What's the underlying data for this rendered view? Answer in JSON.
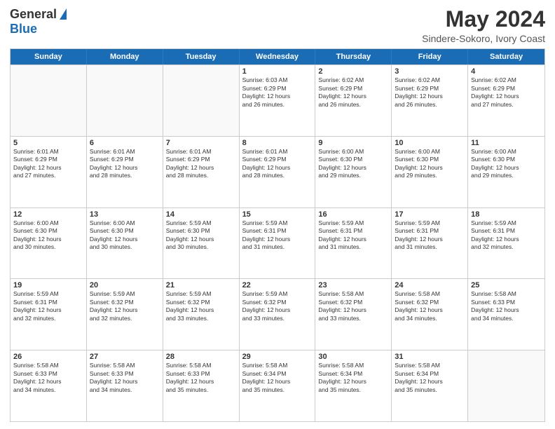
{
  "header": {
    "logo_general": "General",
    "logo_blue": "Blue",
    "month_title": "May 2024",
    "location": "Sindere-Sokoro, Ivory Coast"
  },
  "days_of_week": [
    "Sunday",
    "Monday",
    "Tuesday",
    "Wednesday",
    "Thursday",
    "Friday",
    "Saturday"
  ],
  "weeks": [
    [
      {
        "day": "",
        "info": "",
        "empty": true
      },
      {
        "day": "",
        "info": "",
        "empty": true
      },
      {
        "day": "",
        "info": "",
        "empty": true
      },
      {
        "day": "1",
        "info": "Sunrise: 6:03 AM\nSunset: 6:29 PM\nDaylight: 12 hours\nand 26 minutes.",
        "empty": false
      },
      {
        "day": "2",
        "info": "Sunrise: 6:02 AM\nSunset: 6:29 PM\nDaylight: 12 hours\nand 26 minutes.",
        "empty": false
      },
      {
        "day": "3",
        "info": "Sunrise: 6:02 AM\nSunset: 6:29 PM\nDaylight: 12 hours\nand 26 minutes.",
        "empty": false
      },
      {
        "day": "4",
        "info": "Sunrise: 6:02 AM\nSunset: 6:29 PM\nDaylight: 12 hours\nand 27 minutes.",
        "empty": false
      }
    ],
    [
      {
        "day": "5",
        "info": "Sunrise: 6:01 AM\nSunset: 6:29 PM\nDaylight: 12 hours\nand 27 minutes.",
        "empty": false
      },
      {
        "day": "6",
        "info": "Sunrise: 6:01 AM\nSunset: 6:29 PM\nDaylight: 12 hours\nand 28 minutes.",
        "empty": false
      },
      {
        "day": "7",
        "info": "Sunrise: 6:01 AM\nSunset: 6:29 PM\nDaylight: 12 hours\nand 28 minutes.",
        "empty": false
      },
      {
        "day": "8",
        "info": "Sunrise: 6:01 AM\nSunset: 6:29 PM\nDaylight: 12 hours\nand 28 minutes.",
        "empty": false
      },
      {
        "day": "9",
        "info": "Sunrise: 6:00 AM\nSunset: 6:30 PM\nDaylight: 12 hours\nand 29 minutes.",
        "empty": false
      },
      {
        "day": "10",
        "info": "Sunrise: 6:00 AM\nSunset: 6:30 PM\nDaylight: 12 hours\nand 29 minutes.",
        "empty": false
      },
      {
        "day": "11",
        "info": "Sunrise: 6:00 AM\nSunset: 6:30 PM\nDaylight: 12 hours\nand 29 minutes.",
        "empty": false
      }
    ],
    [
      {
        "day": "12",
        "info": "Sunrise: 6:00 AM\nSunset: 6:30 PM\nDaylight: 12 hours\nand 30 minutes.",
        "empty": false
      },
      {
        "day": "13",
        "info": "Sunrise: 6:00 AM\nSunset: 6:30 PM\nDaylight: 12 hours\nand 30 minutes.",
        "empty": false
      },
      {
        "day": "14",
        "info": "Sunrise: 5:59 AM\nSunset: 6:30 PM\nDaylight: 12 hours\nand 30 minutes.",
        "empty": false
      },
      {
        "day": "15",
        "info": "Sunrise: 5:59 AM\nSunset: 6:31 PM\nDaylight: 12 hours\nand 31 minutes.",
        "empty": false
      },
      {
        "day": "16",
        "info": "Sunrise: 5:59 AM\nSunset: 6:31 PM\nDaylight: 12 hours\nand 31 minutes.",
        "empty": false
      },
      {
        "day": "17",
        "info": "Sunrise: 5:59 AM\nSunset: 6:31 PM\nDaylight: 12 hours\nand 31 minutes.",
        "empty": false
      },
      {
        "day": "18",
        "info": "Sunrise: 5:59 AM\nSunset: 6:31 PM\nDaylight: 12 hours\nand 32 minutes.",
        "empty": false
      }
    ],
    [
      {
        "day": "19",
        "info": "Sunrise: 5:59 AM\nSunset: 6:31 PM\nDaylight: 12 hours\nand 32 minutes.",
        "empty": false
      },
      {
        "day": "20",
        "info": "Sunrise: 5:59 AM\nSunset: 6:32 PM\nDaylight: 12 hours\nand 32 minutes.",
        "empty": false
      },
      {
        "day": "21",
        "info": "Sunrise: 5:59 AM\nSunset: 6:32 PM\nDaylight: 12 hours\nand 33 minutes.",
        "empty": false
      },
      {
        "day": "22",
        "info": "Sunrise: 5:59 AM\nSunset: 6:32 PM\nDaylight: 12 hours\nand 33 minutes.",
        "empty": false
      },
      {
        "day": "23",
        "info": "Sunrise: 5:58 AM\nSunset: 6:32 PM\nDaylight: 12 hours\nand 33 minutes.",
        "empty": false
      },
      {
        "day": "24",
        "info": "Sunrise: 5:58 AM\nSunset: 6:32 PM\nDaylight: 12 hours\nand 34 minutes.",
        "empty": false
      },
      {
        "day": "25",
        "info": "Sunrise: 5:58 AM\nSunset: 6:33 PM\nDaylight: 12 hours\nand 34 minutes.",
        "empty": false
      }
    ],
    [
      {
        "day": "26",
        "info": "Sunrise: 5:58 AM\nSunset: 6:33 PM\nDaylight: 12 hours\nand 34 minutes.",
        "empty": false
      },
      {
        "day": "27",
        "info": "Sunrise: 5:58 AM\nSunset: 6:33 PM\nDaylight: 12 hours\nand 34 minutes.",
        "empty": false
      },
      {
        "day": "28",
        "info": "Sunrise: 5:58 AM\nSunset: 6:33 PM\nDaylight: 12 hours\nand 35 minutes.",
        "empty": false
      },
      {
        "day": "29",
        "info": "Sunrise: 5:58 AM\nSunset: 6:34 PM\nDaylight: 12 hours\nand 35 minutes.",
        "empty": false
      },
      {
        "day": "30",
        "info": "Sunrise: 5:58 AM\nSunset: 6:34 PM\nDaylight: 12 hours\nand 35 minutes.",
        "empty": false
      },
      {
        "day": "31",
        "info": "Sunrise: 5:58 AM\nSunset: 6:34 PM\nDaylight: 12 hours\nand 35 minutes.",
        "empty": false
      },
      {
        "day": "",
        "info": "",
        "empty": true
      }
    ]
  ]
}
